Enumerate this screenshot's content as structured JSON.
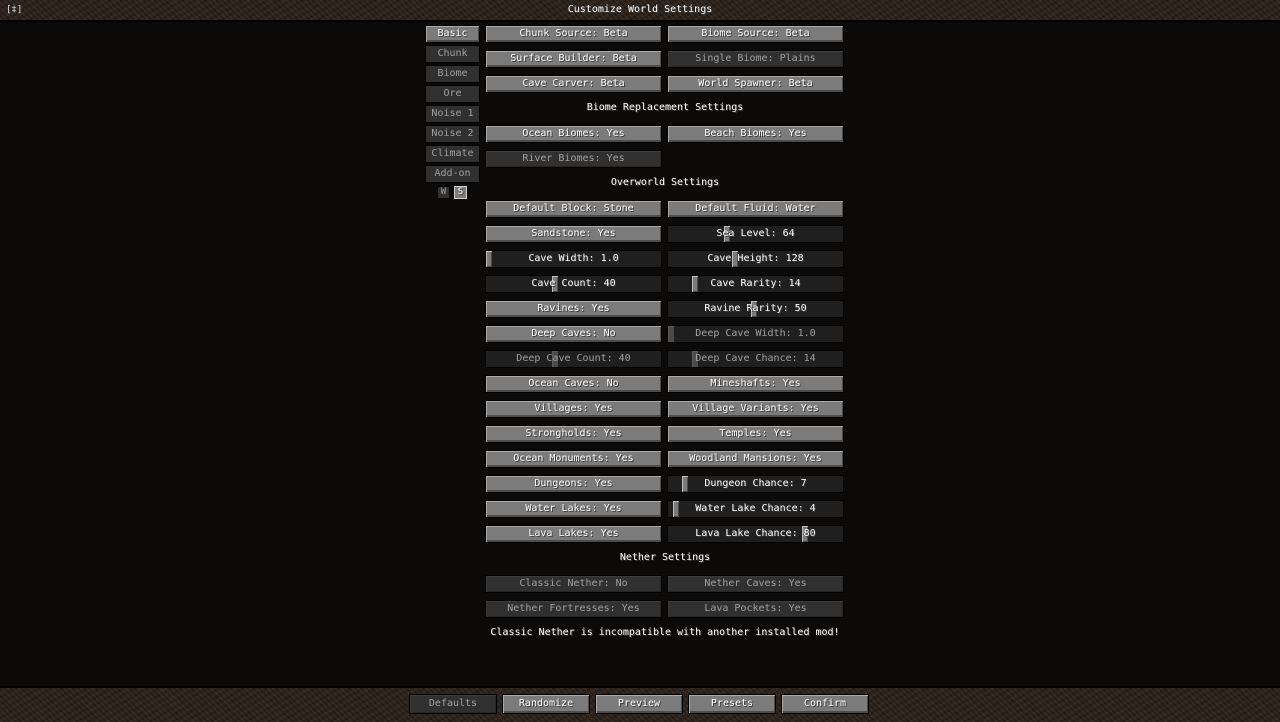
{
  "window": {
    "corner": "[‡]",
    "title": "Customize World Settings"
  },
  "tabs": [
    {
      "label": "Basic"
    },
    {
      "label": "Chunk"
    },
    {
      "label": "Biome"
    },
    {
      "label": "Ore"
    },
    {
      "label": "Noise 1"
    },
    {
      "label": "Noise 2"
    },
    {
      "label": "Climate"
    },
    {
      "label": "Add-on"
    }
  ],
  "mini_buttons": {
    "w": "W",
    "s": "S"
  },
  "source": {
    "chunk_source": "Chunk Source: Beta",
    "biome_source": "Biome Source: Beta",
    "surface_builder": "Surface Builder: Beta",
    "single_biome": "Single Biome: Plains",
    "cave_carver": "Cave Carver: Beta",
    "world_spawner": "World Spawner: Beta"
  },
  "biome_replacement": {
    "heading": "Biome Replacement Settings",
    "ocean_biomes": "Ocean Biomes: Yes",
    "beach_biomes": "Beach Biomes: Yes",
    "river_biomes": "River Biomes: Yes"
  },
  "overworld": {
    "heading": "Overworld Settings",
    "default_block": "Default Block: Stone",
    "default_fluid": "Default Fluid: Water",
    "sandstone": "Sandstone: Yes",
    "sea_level": "Sea Level: 64",
    "cave_width": "Cave Width: 1.0",
    "cave_height": "Cave Height: 128",
    "cave_count": "Cave Count: 40",
    "cave_rarity": "Cave Rarity: 14",
    "ravines": "Ravines: Yes",
    "ravine_rarity": "Ravine Rarity: 50",
    "deep_caves": "Deep Caves: No",
    "deep_cave_width": "Deep Cave Width: 1.0",
    "deep_cave_count": "Deep Cave Count: 40",
    "deep_cave_chance": "Deep Cave Chance: 14",
    "ocean_caves": "Ocean Caves: No",
    "mineshafts": "Mineshafts: Yes",
    "villages": "Villages: Yes",
    "village_variants": "Village Variants: Yes",
    "strongholds": "Strongholds: Yes",
    "temples": "Temples: Yes",
    "ocean_monuments": "Ocean Monuments: Yes",
    "woodland_mansions": "Woodland Mansions: Yes",
    "dungeons": "Dungeons: Yes",
    "dungeon_chance": "Dungeon Chance: 7",
    "water_lakes": "Water Lakes: Yes",
    "water_lake_chance": "Water Lake Chance: 4",
    "lava_lakes": "Lava Lakes: Yes",
    "lava_lake_chance": "Lava Lake Chance: 80"
  },
  "nether": {
    "heading": "Nether Settings",
    "classic_nether": "Classic Nether: No",
    "nether_caves": "Nether Caves: Yes",
    "nether_fortresses": "Nether Fortresses: Yes",
    "lava_pockets": "Lava Pockets: Yes",
    "note": "Classic Nether is incompatible with another installed mod!"
  },
  "slider_levels": {
    "sea_level": 0.33,
    "cave_width": 0.0,
    "cave_height": 0.38,
    "cave_count": 0.39,
    "cave_rarity": 0.14,
    "ravine_rarity": 0.49,
    "deep_cave_width": 0.0,
    "deep_cave_count": 0.39,
    "deep_cave_chance": 0.14,
    "dungeon_chance": 0.08,
    "water_lake_chance": 0.03,
    "lava_lake_chance": 0.79
  },
  "footer": {
    "defaults": "Defaults",
    "randomize": "Randomize",
    "preview": "Preview",
    "presets": "Presets",
    "confirm": "Confirm"
  }
}
